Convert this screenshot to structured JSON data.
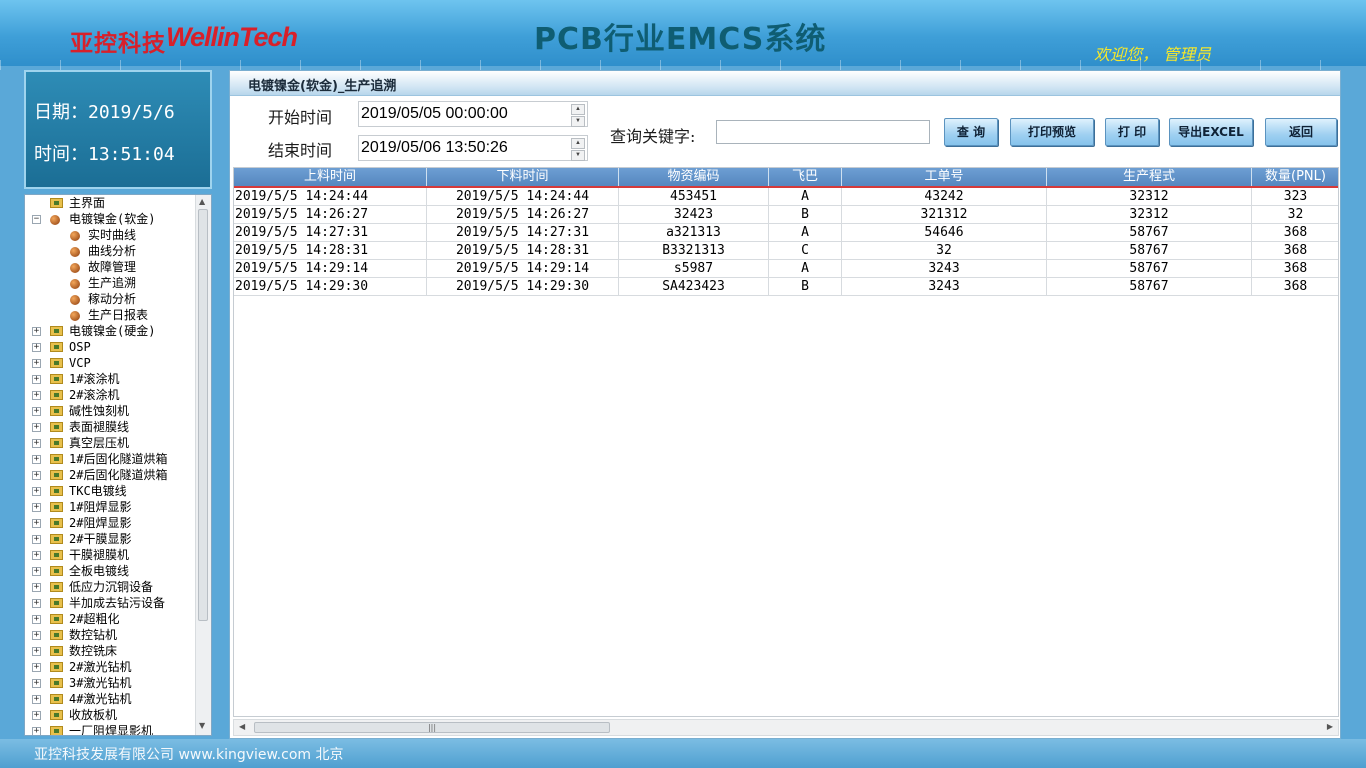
{
  "header": {
    "logo_cn": "亚控科技",
    "logo_en": "WellinTech",
    "app_title": "PCB行业EMCS系统",
    "welcome": "欢迎您， 管理员"
  },
  "clock": {
    "date_label": "日期：",
    "date_value": "2019/5/6",
    "time_label": "时间：",
    "time_value": "13:51:04"
  },
  "tree": [
    {
      "label": "主界面",
      "level": 0,
      "icon": "folder-icon",
      "expander": ""
    },
    {
      "label": "电镀镍金(软金)",
      "level": 0,
      "icon": "node-icon",
      "expander": "−"
    },
    {
      "label": "实时曲线",
      "level": 1,
      "icon": "node-icon",
      "expander": ""
    },
    {
      "label": "曲线分析",
      "level": 1,
      "icon": "node-icon",
      "expander": ""
    },
    {
      "label": "故障管理",
      "level": 1,
      "icon": "node-icon",
      "expander": ""
    },
    {
      "label": "生产追溯",
      "level": 1,
      "icon": "node-icon",
      "expander": ""
    },
    {
      "label": "稼动分析",
      "level": 1,
      "icon": "node-icon",
      "expander": ""
    },
    {
      "label": "生产日报表",
      "level": 1,
      "icon": "node-icon",
      "expander": ""
    },
    {
      "label": "电镀镍金(硬金)",
      "level": 0,
      "icon": "folder-icon",
      "expander": "+"
    },
    {
      "label": "OSP",
      "level": 0,
      "icon": "folder-icon",
      "expander": "+"
    },
    {
      "label": "VCP",
      "level": 0,
      "icon": "folder-icon",
      "expander": "+"
    },
    {
      "label": "1#滚涂机",
      "level": 0,
      "icon": "folder-icon",
      "expander": "+"
    },
    {
      "label": "2#滚涂机",
      "level": 0,
      "icon": "folder-icon",
      "expander": "+"
    },
    {
      "label": "碱性蚀刻机",
      "level": 0,
      "icon": "folder-icon",
      "expander": "+"
    },
    {
      "label": "表面褪膜线",
      "level": 0,
      "icon": "folder-icon",
      "expander": "+"
    },
    {
      "label": "真空层压机",
      "level": 0,
      "icon": "folder-icon",
      "expander": "+"
    },
    {
      "label": "1#后固化隧道烘箱",
      "level": 0,
      "icon": "folder-icon",
      "expander": "+"
    },
    {
      "label": "2#后固化隧道烘箱",
      "level": 0,
      "icon": "folder-icon",
      "expander": "+"
    },
    {
      "label": "TKC电镀线",
      "level": 0,
      "icon": "folder-icon",
      "expander": "+"
    },
    {
      "label": "1#阻焊显影",
      "level": 0,
      "icon": "folder-icon",
      "expander": "+"
    },
    {
      "label": "2#阻焊显影",
      "level": 0,
      "icon": "folder-icon",
      "expander": "+"
    },
    {
      "label": "2#干膜显影",
      "level": 0,
      "icon": "folder-icon",
      "expander": "+"
    },
    {
      "label": "干膜褪膜机",
      "level": 0,
      "icon": "folder-icon",
      "expander": "+"
    },
    {
      "label": "全板电镀线",
      "level": 0,
      "icon": "folder-icon",
      "expander": "+"
    },
    {
      "label": "低应力沉铜设备",
      "level": 0,
      "icon": "folder-icon",
      "expander": "+"
    },
    {
      "label": "半加成去钻污设备",
      "level": 0,
      "icon": "folder-icon",
      "expander": "+"
    },
    {
      "label": "2#超粗化",
      "level": 0,
      "icon": "folder-icon",
      "expander": "+"
    },
    {
      "label": "数控钻机",
      "level": 0,
      "icon": "folder-icon",
      "expander": "+"
    },
    {
      "label": "数控铣床",
      "level": 0,
      "icon": "folder-icon",
      "expander": "+"
    },
    {
      "label": "2#激光钻机",
      "level": 0,
      "icon": "folder-icon",
      "expander": "+"
    },
    {
      "label": "3#激光钻机",
      "level": 0,
      "icon": "folder-icon",
      "expander": "+"
    },
    {
      "label": "4#激光钻机",
      "level": 0,
      "icon": "folder-icon",
      "expander": "+"
    },
    {
      "label": "收放板机",
      "level": 0,
      "icon": "folder-icon",
      "expander": "+"
    },
    {
      "label": "一厂阻焊显影机",
      "level": 0,
      "icon": "folder-icon",
      "expander": "+"
    }
  ],
  "panel": {
    "title": "电镀镍金(软金)_生产追溯",
    "start_label": "开始时间",
    "start_value": "2019/05/05 00:00:00",
    "end_label": "结束时间",
    "end_value": "2019/05/06 13:50:26",
    "keyword_label": "查询关键字:",
    "keyword_value": "",
    "buttons": {
      "query": "查 询",
      "print_preview": "打印预览",
      "print": "打 印",
      "export": "导出EXCEL",
      "back": "返回"
    }
  },
  "table": {
    "columns": [
      "上料时间",
      "下料时间",
      "物资编码",
      "飞巴",
      "工单号",
      "生产程式",
      "数量(PNL)"
    ],
    "rows": [
      [
        "2019/5/5 14:24:44",
        "2019/5/5 14:24:44",
        "453451",
        "A",
        "43242",
        "32312",
        "323"
      ],
      [
        "2019/5/5 14:26:27",
        "2019/5/5 14:26:27",
        "32423",
        "B",
        "321312",
        "32312",
        "32"
      ],
      [
        "2019/5/5 14:27:31",
        "2019/5/5 14:27:31",
        "a321313",
        "A",
        "54646",
        "58767",
        "368"
      ],
      [
        "2019/5/5 14:28:31",
        "2019/5/5 14:28:31",
        "B3321313",
        "C",
        "32",
        "58767",
        "368"
      ],
      [
        "2019/5/5 14:29:14",
        "2019/5/5 14:29:14",
        "s5987",
        "A",
        "3243",
        "58767",
        "368"
      ],
      [
        "2019/5/5 14:29:30",
        "2019/5/5 14:29:30",
        "SA423423",
        "B",
        "3243",
        "58767",
        "368"
      ]
    ]
  },
  "footer": {
    "text": "亚控科技发展有限公司 www.kingview.com 北京"
  }
}
